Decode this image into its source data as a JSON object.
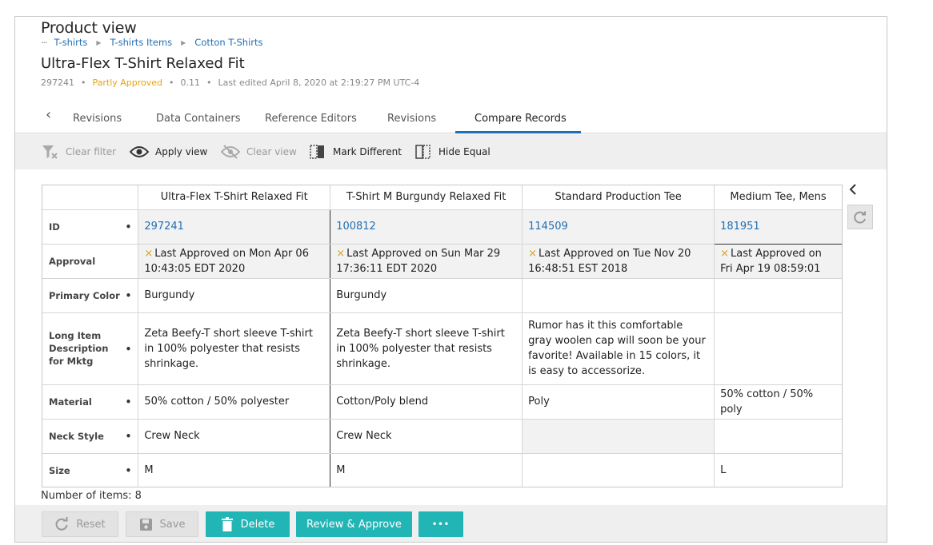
{
  "header": {
    "title": "Product view",
    "breadcrumb": [
      "T-shirts",
      "T-shirts Items",
      "Cotton T-Shirts"
    ],
    "item_title": "Ultra-Flex T-Shirt Relaxed Fit",
    "meta": {
      "id": "297241",
      "status": "Partly Approved",
      "version": "0.11",
      "last_edited": "Last edited April 8, 2020 at 2:19:27 PM UTC-4"
    }
  },
  "tabs": [
    "Revisions",
    "Data Containers",
    "Reference Editors",
    "Revisions",
    "Compare Records"
  ],
  "active_tab": "Compare Records",
  "toolbar": {
    "clear_filter": "Clear filter",
    "apply_view": "Apply view",
    "clear_view": "Clear view",
    "mark_different": "Mark Different",
    "hide_equal": "Hide Equal"
  },
  "compare": {
    "columns": [
      "Ultra-Flex T-Shirt Relaxed Fit",
      "T-Shirt M Burgundy Relaxed Fit",
      "Standard Production Tee",
      "Medium Tee, Mens"
    ],
    "rows": [
      {
        "label": "ID",
        "bullet": "•",
        "values": [
          "297241",
          "100812",
          "114509",
          "181951"
        ]
      },
      {
        "label": "Approval",
        "bullet": "",
        "values": [
          "Last Approved on Mon Apr 06 10:43:05 EDT 2020",
          "Last Approved on Sun Mar 29 17:36:11 EDT 2020",
          "Last Approved on Tue Nov 20 16:48:51 EST 2018",
          "Last Approved on Fri Apr 19 08:59:01"
        ]
      },
      {
        "label": "Primary Color",
        "bullet": "•",
        "values": [
          "Burgundy",
          "Burgundy",
          "",
          ""
        ]
      },
      {
        "label": "Long Item Description for Mktg",
        "bullet": "•",
        "values": [
          "Zeta Beefy-T short sleeve T-shirt in 100% polyester that resists shrinkage.",
          "Zeta Beefy-T short sleeve T-shirt in 100% polyester that resists shrinkage.",
          "Rumor has it this comfortable gray woolen cap will soon be your favorite! Available in 15 colors, it is easy to accessorize.",
          ""
        ]
      },
      {
        "label": "Material",
        "bullet": "•",
        "values": [
          "50% cotton / 50% polyester",
          "Cotton/Poly blend",
          "Poly",
          "50% cotton / 50% poly"
        ]
      },
      {
        "label": "Neck Style",
        "bullet": "•",
        "values": [
          "Crew Neck",
          "Crew Neck",
          "",
          ""
        ]
      },
      {
        "label": "Size",
        "bullet": "•",
        "values": [
          "M",
          "M",
          "",
          "L"
        ]
      }
    ]
  },
  "x_mark": "×",
  "item_count": "Number of items: 8",
  "footer": {
    "reset": "Reset",
    "save": "Save",
    "delete": "Delete",
    "review_approve": "Review & Approve",
    "more": "•••"
  },
  "colors": {
    "accent_blue": "#1f6fb5",
    "status_orange": "#e8a20c",
    "teal_button": "#22b5b5",
    "toolbar_bg": "#efefef"
  }
}
